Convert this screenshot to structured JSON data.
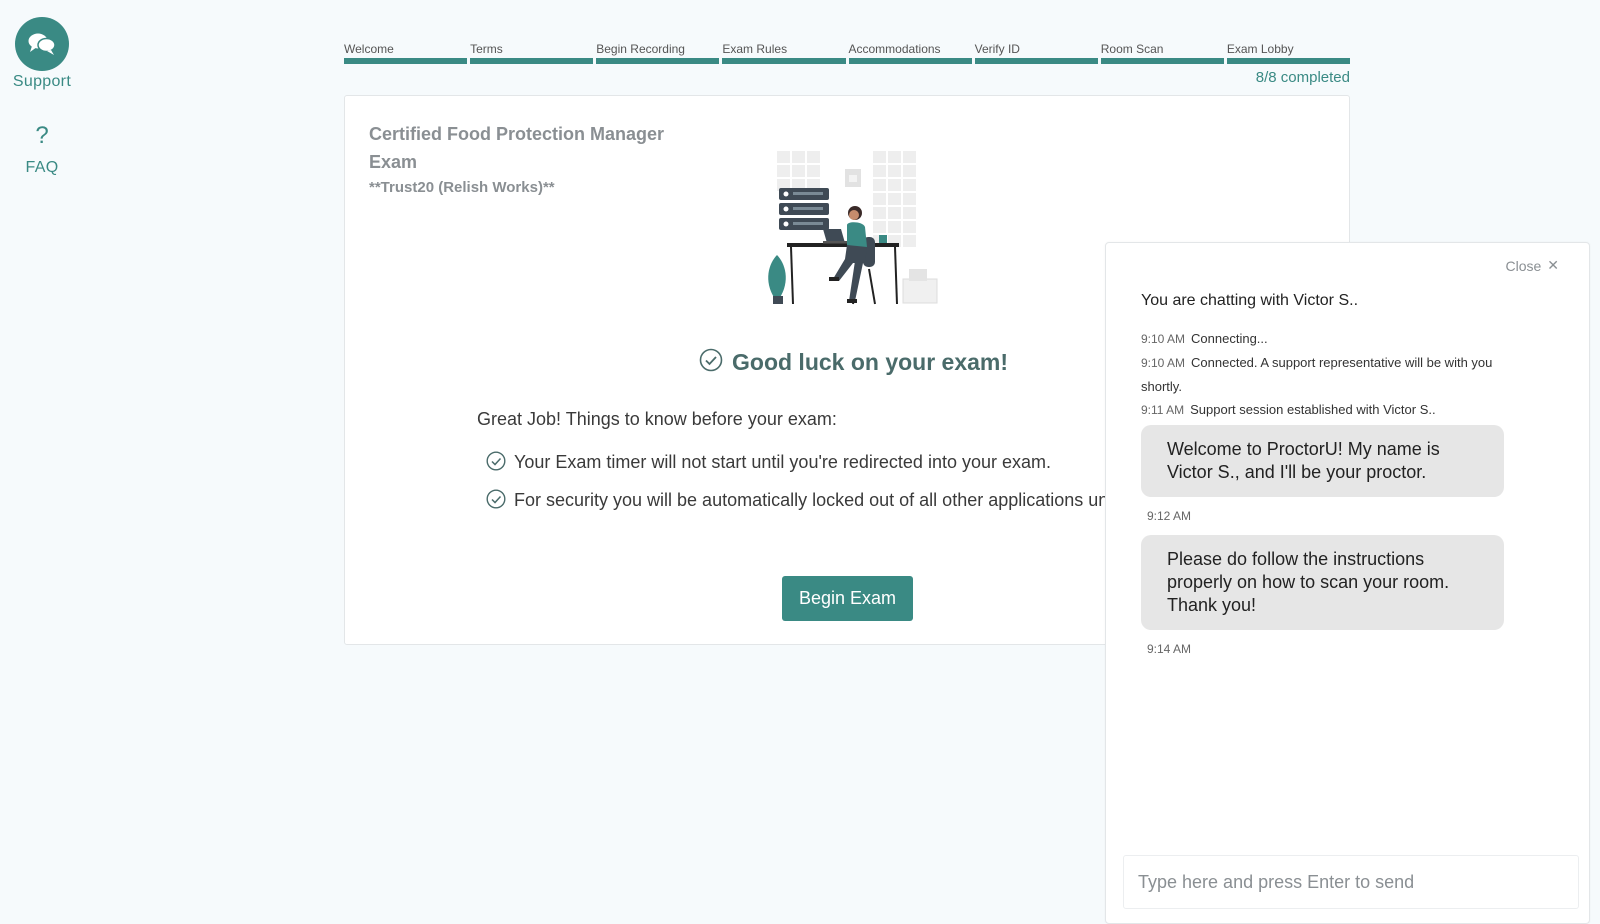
{
  "sidebar": {
    "support_label": "Support",
    "faq_symbol": "?",
    "faq_label": "FAQ"
  },
  "steps": [
    {
      "label": "Welcome"
    },
    {
      "label": "Terms"
    },
    {
      "label": "Begin Recording"
    },
    {
      "label": "Exam Rules"
    },
    {
      "label": "Accommodations"
    },
    {
      "label": "Verify ID"
    },
    {
      "label": "Room Scan"
    },
    {
      "label": "Exam Lobby"
    }
  ],
  "progress": {
    "completed": 8,
    "total": 8,
    "text": "8/8 completed"
  },
  "card": {
    "title": "Certified Food Protection Manager Exam",
    "subtitle": "**Trust20 (Relish Works)**",
    "good_luck": "Good luck on your exam!",
    "intro": "Great Job! Things to know before your exam:",
    "tips": [
      "Your Exam timer will not start until you're redirected into your exam.",
      "For security you will be automatically locked out of all other applications until you complete the exam."
    ],
    "begin_button": "Begin Exam"
  },
  "chat": {
    "close_label": "Close",
    "close_symbol": "✕",
    "chatting_with": "You are chatting with Victor S..",
    "log": [
      {
        "time": "9:10 AM",
        "text": "Connecting..."
      },
      {
        "time": "9:10 AM",
        "text": "Connected. A support representative will be with you shortly."
      },
      {
        "time": "9:11 AM",
        "text": "Support session established with Victor S.."
      }
    ],
    "messages": [
      {
        "text": "Welcome to ProctorU! My name is Victor S., and I'll be your proctor.",
        "time": "9:12 AM"
      },
      {
        "text": "Please do follow the instructions properly on how to scan your room. Thank you!",
        "time": "9:14 AM"
      }
    ],
    "input_placeholder": "Type here and press Enter to send"
  },
  "colors": {
    "accent": "#3a8a84",
    "background": "#f6fafc",
    "bubble": "#e6e6e6"
  }
}
